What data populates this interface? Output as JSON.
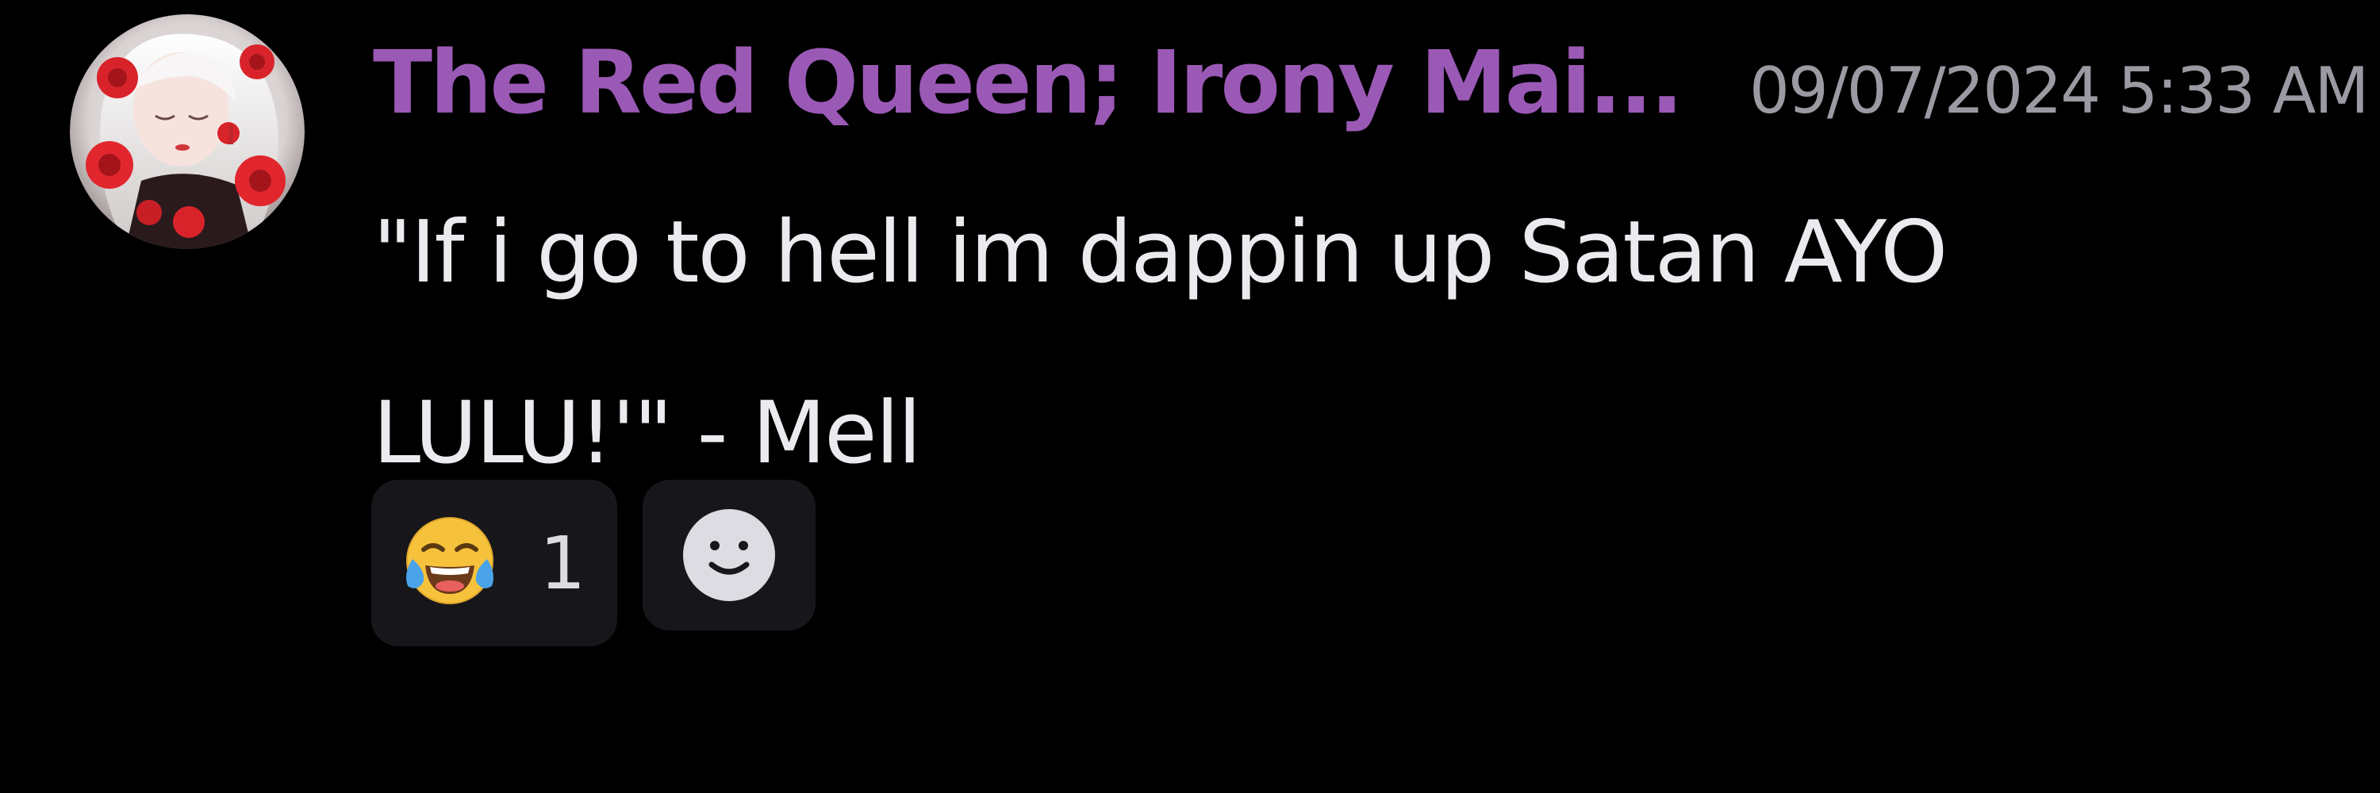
{
  "message": {
    "author": {
      "name": "The Red Queen; Irony Mai...",
      "name_color": "#9b59b6",
      "avatar_icon": "avatar-image"
    },
    "timestamp": "09/07/2024 5:33 AM",
    "content_lines": [
      "\"If i go to hell im dappin up Satan AYO",
      "LULU!'\" - Mell"
    ],
    "reactions": [
      {
        "emoji": "face-with-tears-of-joy",
        "count": "1"
      }
    ],
    "add_reaction_icon": "smiley-add-reaction-icon"
  },
  "colors": {
    "background": "#000000",
    "reaction_bg": "#17171b",
    "timestamp": "#9a9aa3",
    "text": "#ebebef"
  }
}
